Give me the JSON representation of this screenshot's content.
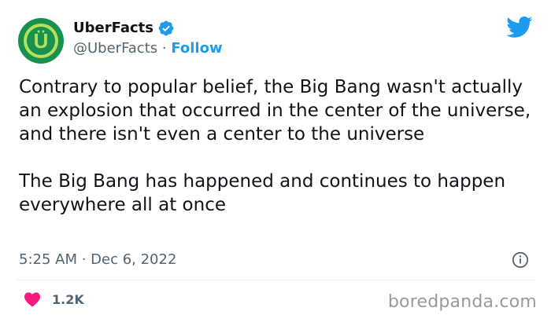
{
  "author": {
    "display_name": "UberFacts",
    "handle": "@UberFacts",
    "separator": " · ",
    "follow_label": "Follow",
    "avatar_letter": "Ü",
    "verified_icon": "verified-badge-icon"
  },
  "tweet": {
    "paragraphs": [
      "Contrary to popular belief, the Big Bang wasn't actually an explosion that occurred in the center of the universe, and there isn't even a center to the universe",
      "The Big Bang has happened and continues to happen everywhere all at once"
    ]
  },
  "meta": {
    "timestamp": "5:25 AM · Dec 6, 2022"
  },
  "engagement": {
    "likes": "1.2K"
  },
  "watermark": "boredpanda.com",
  "colors": {
    "accent_blue": "#1d9bf0",
    "like_pink": "#f91880",
    "avatar_green": "#16914f",
    "avatar_lime": "#b6e05a",
    "secondary_text": "#536471"
  },
  "icons": [
    "twitter-bird-icon",
    "verified-badge-icon",
    "info-icon",
    "heart-icon"
  ]
}
